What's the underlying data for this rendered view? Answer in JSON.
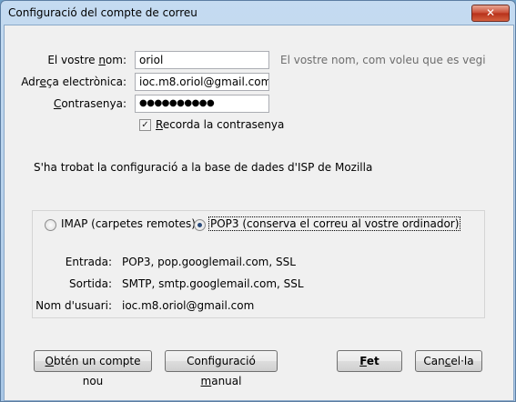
{
  "window": {
    "title": "Configuració del compte de correu",
    "close_glyph": "✕"
  },
  "form": {
    "name": {
      "label_pre": "El vostre ",
      "label_ul": "n",
      "label_post": "om:",
      "value": "oriol",
      "hint": "El vostre nom, com voleu que es vegi"
    },
    "email": {
      "label_pre": "Adr",
      "label_ul": "e",
      "label_post": "ça electrònica:",
      "value": "ioc.m8.oriol@gmail.com"
    },
    "password": {
      "label_pre": "",
      "label_ul": "C",
      "label_post": "ontrasenya:",
      "value": "●●●●●●●●●●"
    },
    "remember": {
      "checked_glyph": "✓",
      "label_pre": "",
      "label_ul": "R",
      "label_post": "ecorda la contrasenya"
    }
  },
  "status_message": "S'ha trobat la configuració a la base de dades d'ISP de Mozilla",
  "protocol": {
    "imap_label": "IMAP (carpetes remotes)",
    "pop3_label": "POP3 (conserva el correu al vostre ordinador)",
    "selected": "POP3"
  },
  "details": [
    {
      "label": "Entrada:",
      "value": "POP3, pop.googlemail.com, SSL"
    },
    {
      "label": "Sortida:",
      "value": "SMTP, smtp.googlemail.com, SSL"
    },
    {
      "label": "Nom d'usuari:",
      "value": "ioc.m8.oriol@gmail.com"
    }
  ],
  "buttons": {
    "new_account": {
      "pre": "",
      "ul": "O",
      "post": "btén un compte nou"
    },
    "manual_config": {
      "pre": "Configuració ",
      "ul": "m",
      "post": "anual"
    },
    "done": {
      "pre": "",
      "ul": "F",
      "post": "et"
    },
    "cancel": {
      "pre": "Can",
      "ul": "c",
      "post": "el·la"
    }
  }
}
